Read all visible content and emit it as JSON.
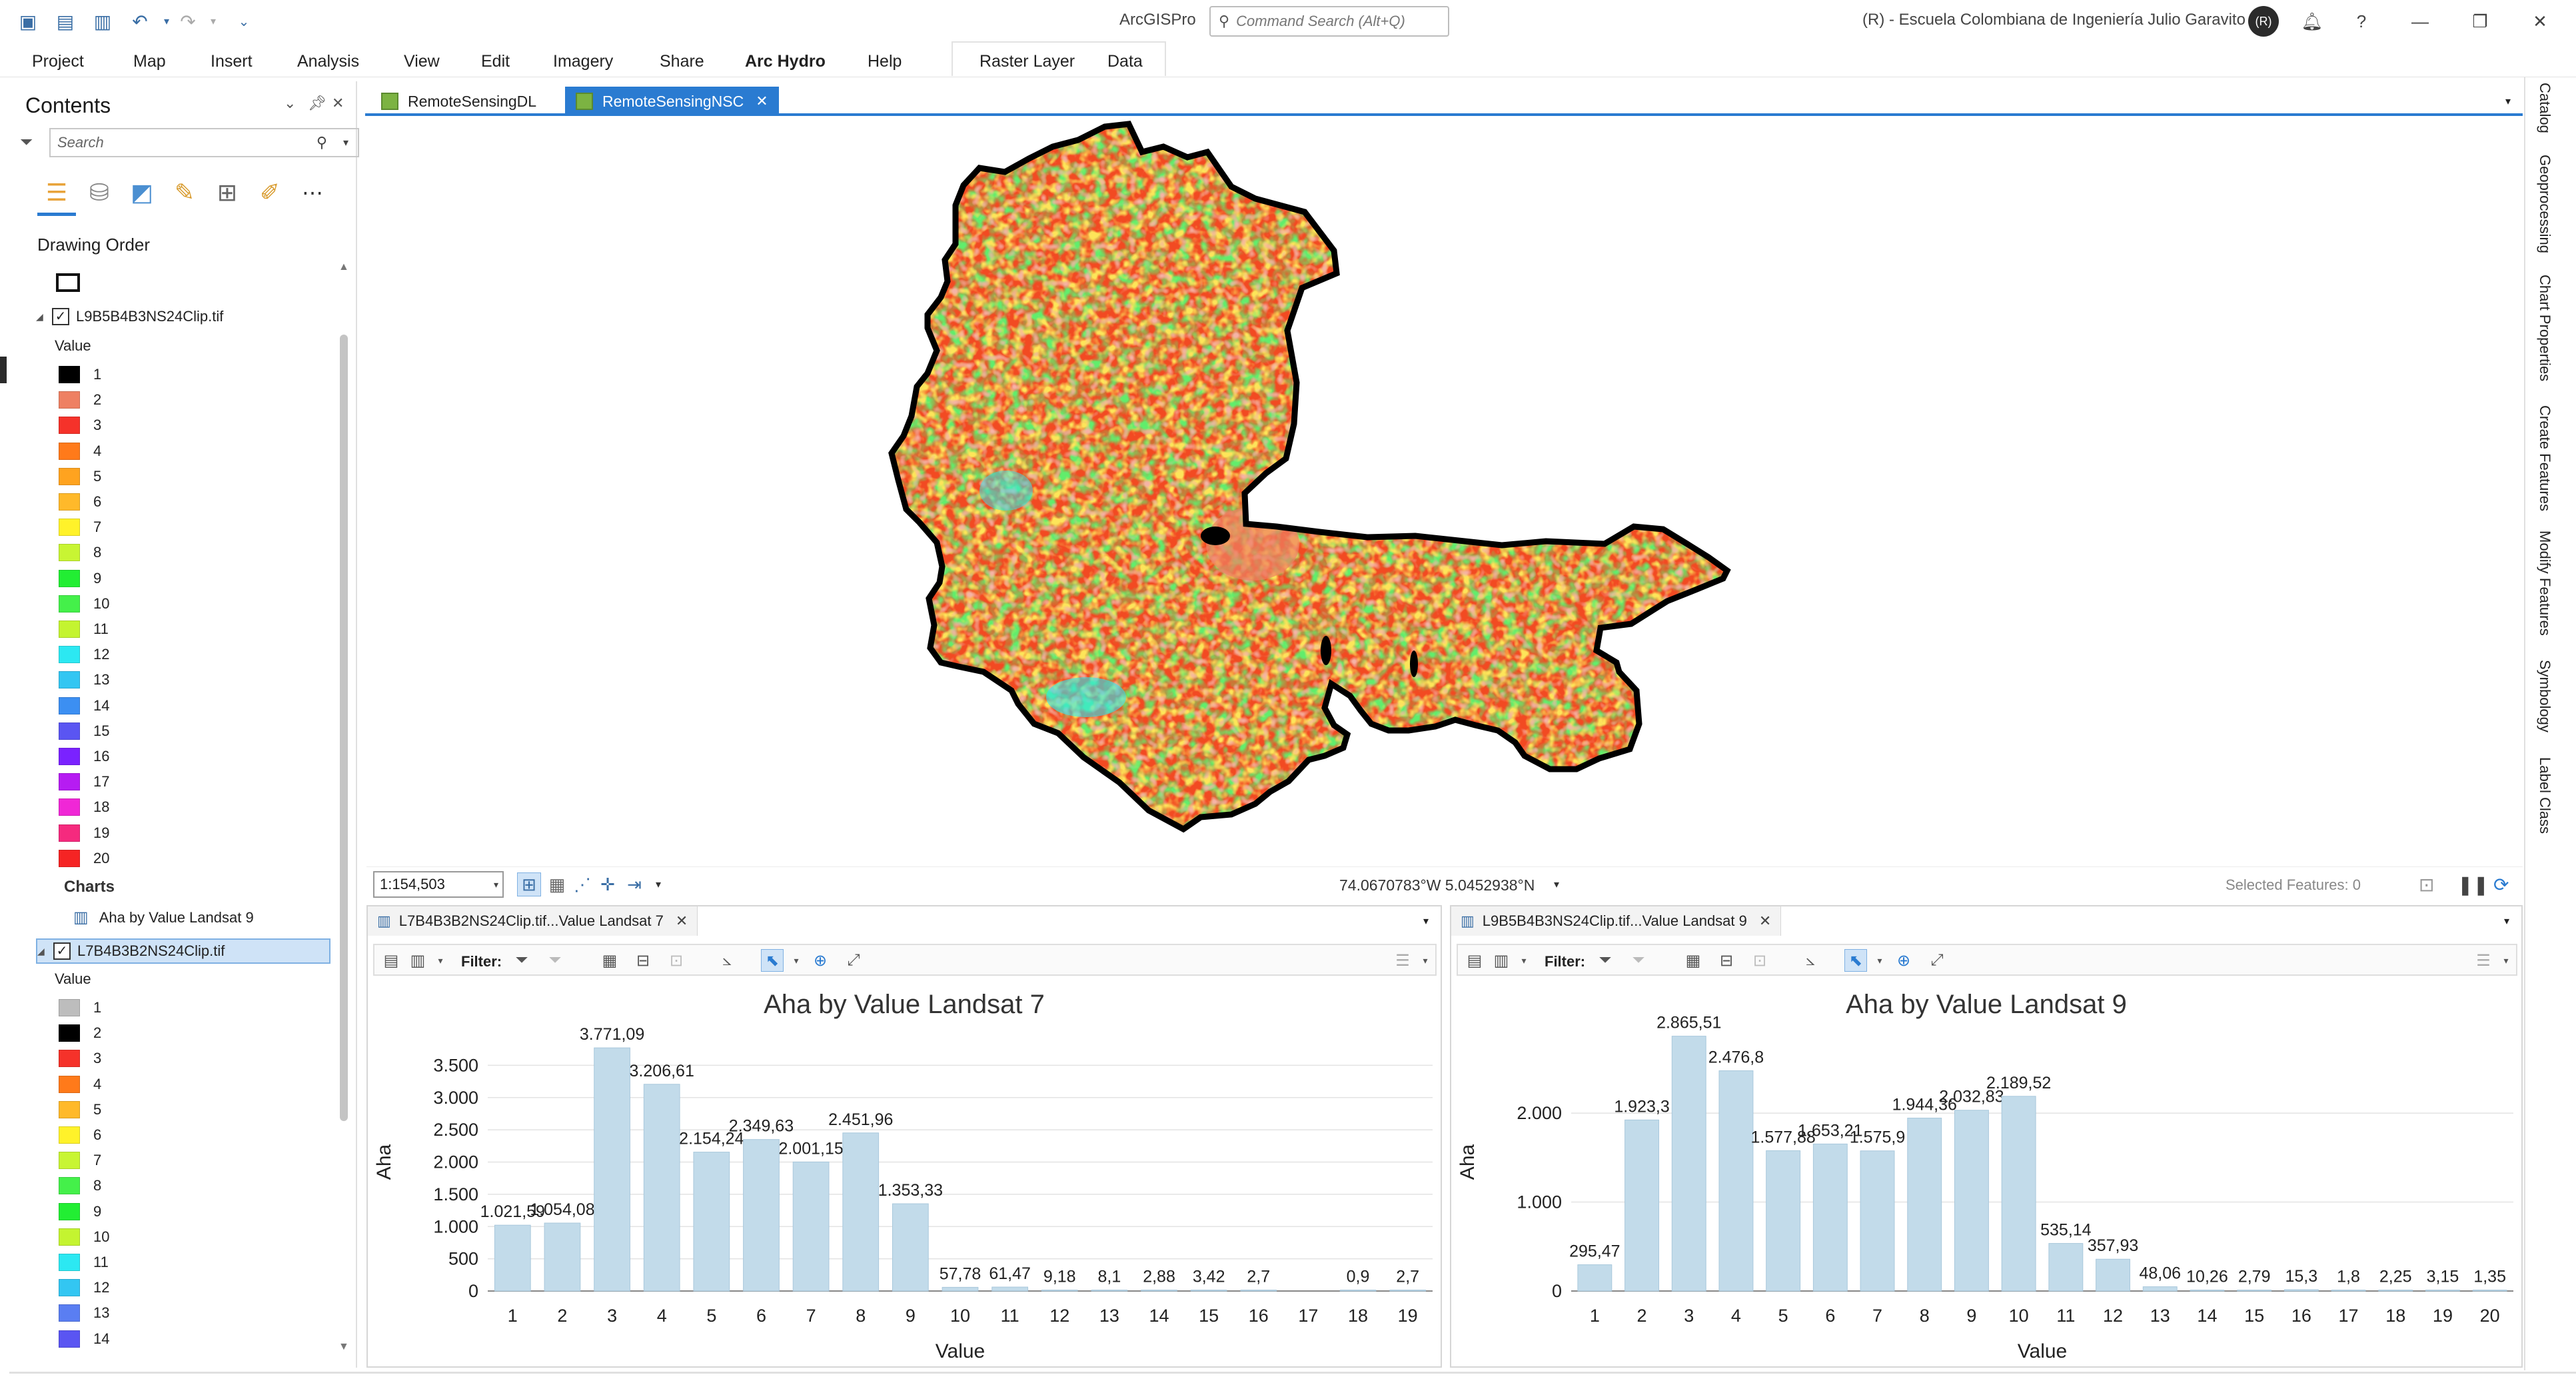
{
  "window": {
    "app_title": "ArcGISPro",
    "search_placeholder": "Command Search (Alt+Q)",
    "org": "(R) - Escuela Colombiana de Ingeniería Julio Garavito",
    "avatar_initials": "(R)",
    "help": "?"
  },
  "ribbon": {
    "tabs": [
      "Project",
      "Map",
      "Insert",
      "Analysis",
      "View",
      "Edit",
      "Imagery",
      "Share",
      "Arc Hydro",
      "Help"
    ],
    "active_tab": "Arc Hydro",
    "context_tabs": [
      "Raster Layer",
      "Data"
    ]
  },
  "contents": {
    "title": "Contents",
    "search_placeholder": "Search",
    "drawing_order": "Drawing Order",
    "layer1": {
      "name": "L9B5B4B3NS24Clip.tif",
      "value_header": "Value",
      "checked": true,
      "items": [
        {
          "label": "1",
          "color": "#000000"
        },
        {
          "label": "2",
          "color": "#ee8063"
        },
        {
          "label": "3",
          "color": "#f5322a"
        },
        {
          "label": "4",
          "color": "#ff7a1a"
        },
        {
          "label": "5",
          "color": "#ffa31f"
        },
        {
          "label": "6",
          "color": "#ffb92a"
        },
        {
          "label": "7",
          "color": "#fff22a"
        },
        {
          "label": "8",
          "color": "#c8f533"
        },
        {
          "label": "9",
          "color": "#22ee33"
        },
        {
          "label": "10",
          "color": "#44f04a"
        },
        {
          "label": "11",
          "color": "#c4f430"
        },
        {
          "label": "12",
          "color": "#2ce8f2"
        },
        {
          "label": "13",
          "color": "#33c6f2"
        },
        {
          "label": "14",
          "color": "#3c8ff2"
        },
        {
          "label": "15",
          "color": "#5a55f2"
        },
        {
          "label": "16",
          "color": "#7a22ff"
        },
        {
          "label": "17",
          "color": "#b61cf2"
        },
        {
          "label": "18",
          "color": "#f027d6"
        },
        {
          "label": "19",
          "color": "#f52a7e"
        },
        {
          "label": "20",
          "color": "#f52424"
        }
      ]
    },
    "charts_header": "Charts",
    "chart_item": "Aha by Value Landsat 9",
    "layer2": {
      "name": "L7B4B3B2NS24Clip.tif",
      "value_header": "Value",
      "checked": true,
      "items": [
        {
          "label": "1",
          "color": "#bdbdbd"
        },
        {
          "label": "2",
          "color": "#000000"
        },
        {
          "label": "3",
          "color": "#f5322a"
        },
        {
          "label": "4",
          "color": "#ff7a1a"
        },
        {
          "label": "5",
          "color": "#ffb92a"
        },
        {
          "label": "6",
          "color": "#fff22a"
        },
        {
          "label": "7",
          "color": "#c8f533"
        },
        {
          "label": "8",
          "color": "#44f04a"
        },
        {
          "label": "9",
          "color": "#22ee33"
        },
        {
          "label": "10",
          "color": "#c4f430"
        },
        {
          "label": "11",
          "color": "#2ce8f2"
        },
        {
          "label": "12",
          "color": "#33c6f2"
        },
        {
          "label": "13",
          "color": "#5a7ef2"
        },
        {
          "label": "14",
          "color": "#5a55f2"
        }
      ]
    }
  },
  "map": {
    "tabs": [
      "RemoteSensingDL",
      "RemoteSensingNSC"
    ],
    "active_tab": "RemoteSensingNSC",
    "scale": "1:154,503",
    "coords": "74.0670783°W 5.0452938°N",
    "selected_features": "Selected Features: 0"
  },
  "charts_panels": [
    {
      "tab": "L7B4B3B2NS24Clip.tif...Value Landsat 7",
      "filter_label": "Filter:"
    },
    {
      "tab": "L9B5B4B3NS24Clip.tif...Value Landsat 9",
      "filter_label": "Filter:"
    }
  ],
  "chart_data": [
    {
      "type": "bar",
      "title": "Aha by Value Landsat 7",
      "xlabel": "Value",
      "ylabel": "Aha",
      "categories": [
        "1",
        "2",
        "3",
        "4",
        "5",
        "6",
        "7",
        "8",
        "9",
        "10",
        "11",
        "12",
        "13",
        "14",
        "15",
        "16",
        "18",
        "19"
      ],
      "values": [
        1021.59,
        1054.08,
        3771.09,
        3206.61,
        2154.24,
        2349.63,
        2001.15,
        2451.96,
        1353.33,
        57.78,
        61.47,
        9.18,
        8.1,
        2.88,
        3.42,
        2.7,
        0.9,
        2.7
      ],
      "data_labels": [
        "1.021,59",
        "1.054,08",
        "3.771,09",
        "3.206,61",
        "2.154,24",
        "2.349,63",
        "2.001,15",
        "2.451,96",
        "1.353,33",
        "57,78",
        "61,47",
        "9,18",
        "8,1",
        "2,88",
        "3,42",
        "2,7",
        "0,9",
        "2,7"
      ],
      "xticks": [
        "1",
        "2",
        "3",
        "4",
        "5",
        "6",
        "7",
        "8",
        "9",
        "10",
        "11",
        "12",
        "13",
        "14",
        "15",
        "16",
        "17",
        "18",
        "19"
      ],
      "yticks": [
        "0",
        "500",
        "1.000",
        "1.500",
        "2.000",
        "2.500",
        "3.000",
        "3.500"
      ],
      "ytick_values": [
        0,
        500,
        1000,
        1500,
        2000,
        2500,
        3000,
        3500
      ],
      "ylim": [
        0,
        4000
      ],
      "grid": true,
      "bar_color": "#c2dbea"
    },
    {
      "type": "bar",
      "title": "Aha by Value Landsat 9",
      "xlabel": "Value",
      "ylabel": "Aha",
      "categories": [
        "1",
        "2",
        "3",
        "4",
        "5",
        "6",
        "7",
        "8",
        "9",
        "10",
        "11",
        "12",
        "13",
        "14",
        "15",
        "16",
        "17",
        "18",
        "19",
        "20"
      ],
      "values": [
        295.47,
        1923.3,
        2865.51,
        2476.8,
        1577.88,
        1653.21,
        1575.9,
        1944.36,
        2032.83,
        2189.52,
        535.14,
        357.93,
        48.06,
        10.26,
        2.79,
        15.3,
        1.8,
        2.25,
        3.15,
        1.35
      ],
      "data_labels": [
        "295,47",
        "1.923,3",
        "2.865,51",
        "2.476,8",
        "1.577,88",
        "1.653,21",
        "1.575,9",
        "1.944,36",
        "2.032,83",
        "2.189,52",
        "535,14",
        "357,93",
        "48,06",
        "10,26",
        "2,79",
        "15,3",
        "1,8",
        "2,25",
        "3,15",
        "1,35"
      ],
      "xticks": [
        "1",
        "2",
        "3",
        "4",
        "5",
        "6",
        "7",
        "8",
        "9",
        "10",
        "11",
        "12",
        "13",
        "14",
        "15",
        "16",
        "17",
        "18",
        "19",
        "20"
      ],
      "yticks": [
        "0",
        "1.000",
        "2.000"
      ],
      "ytick_values": [
        0,
        1000,
        2000
      ],
      "ylim": [
        0,
        2900
      ],
      "grid": true,
      "bar_color": "#c2dbea"
    }
  ],
  "right_panes": [
    "Catalog",
    "Geoprocessing",
    "Chart Properties",
    "Create Features",
    "Modify Features",
    "Symbology",
    "Label Class"
  ],
  "icons": {
    "qat": [
      "new-project-icon",
      "open-project-icon",
      "save-project-icon",
      "undo-icon",
      "redo-icon",
      "customize-icon"
    ],
    "title_right": [
      "notification-bell-icon",
      "help-icon",
      "minimize-icon",
      "restore-icon",
      "close-icon"
    ]
  }
}
